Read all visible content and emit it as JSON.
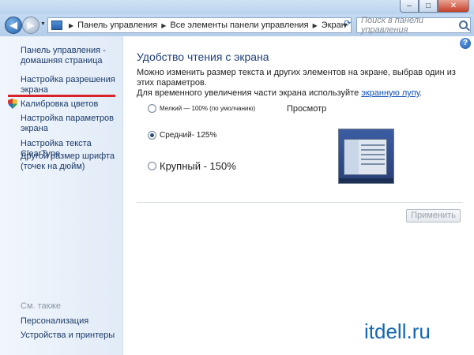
{
  "window": {
    "minimize_label": "‒",
    "maximize_label": "□",
    "close_label": "✕"
  },
  "address": {
    "crumbs": [
      "Панель управления",
      "Все элементы панели управления",
      "Экран"
    ],
    "search_placeholder": "Поиск в панели управления"
  },
  "sidebar": {
    "home_line1": "Панель управления -",
    "home_line2": "домашняя страница",
    "res_line1": "Настройка разрешения",
    "res_line2": "экрана",
    "calibrate": "Калибровка цветов",
    "params_line1": "Настройка параметров",
    "params_line2": "экрана",
    "cleartype": "Настройка текста ClearType",
    "font_line1": "Другой размер шрифта",
    "font_line2": "(точек на дюйм)",
    "see_also": "См. также",
    "personalization": "Персонализация",
    "devices": "Устройства и принтеры"
  },
  "main": {
    "title": "Удобство чтения с экрана",
    "desc_line1": "Можно изменить размер текста и других элементов на экране, выбрав один из этих параметров.",
    "desc_line2_prefix": "Для временного увеличения части экрана используйте ",
    "desc_link": "экранную лупу",
    "desc_suffix": ".",
    "options": [
      {
        "label": "Мелкий — 100% (по умолчанию)",
        "checked": false
      },
      {
        "label": "Средний- 125%",
        "checked": true
      },
      {
        "label": "Крупный - 150%",
        "checked": false
      }
    ],
    "preview_label": "Просмотр",
    "apply_label": "Применить"
  },
  "watermark": "itdell.ru",
  "colors": {
    "accent": "#1f3f78",
    "link": "#0f4fb8",
    "highlight_line": "#d8232a"
  }
}
